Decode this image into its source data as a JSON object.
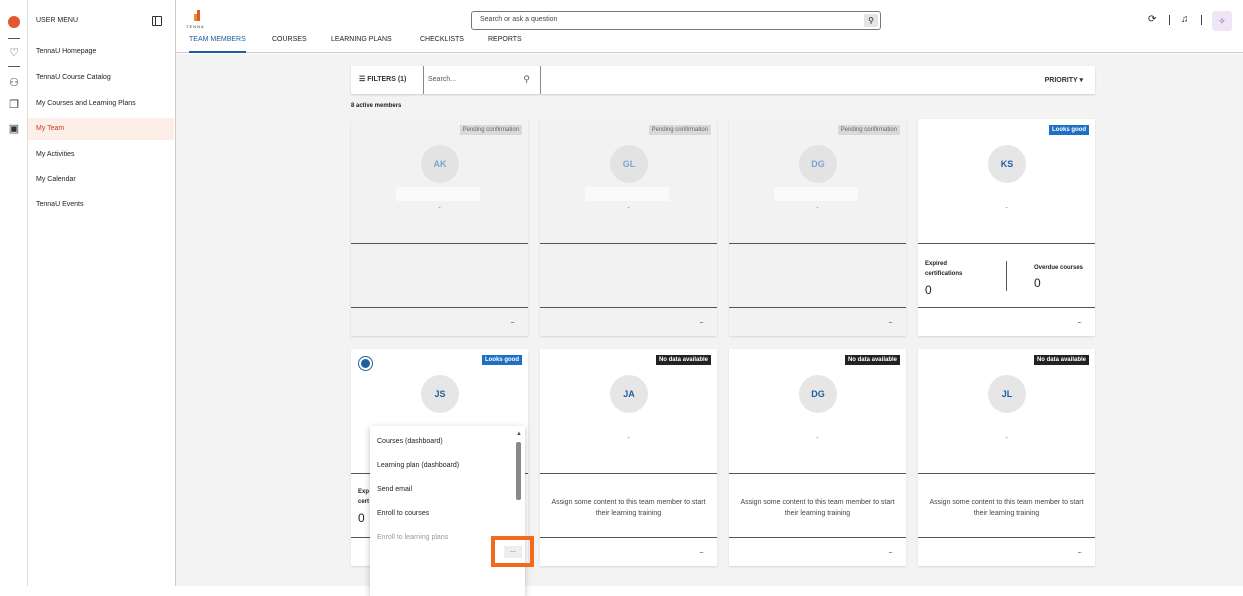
{
  "sidebar": {
    "header": "USER MENU",
    "items": [
      {
        "label": "TennaU Homepage",
        "active": false
      },
      {
        "label": "TennaU Course Catalog",
        "active": false
      },
      {
        "label": "My Courses and Learning Plans",
        "active": false
      },
      {
        "label": "My Team",
        "active": true
      },
      {
        "label": "My Activities",
        "active": false
      },
      {
        "label": "My Calendar",
        "active": false
      },
      {
        "label": "TennaU Events",
        "active": false
      }
    ]
  },
  "brand": {
    "name": "TENNA"
  },
  "search": {
    "placeholder": "Search or ask a question"
  },
  "tabs": [
    "TEAM MEMBERS",
    "COURSES",
    "LEARNING PLANS",
    "CHECKLISTS",
    "REPORTS"
  ],
  "filterbar": {
    "filters_label": "FILTERS (1)",
    "search_placeholder": "Search...",
    "sort_label": "PRIORITY"
  },
  "member_count": "8 active members",
  "cards": [
    {
      "initials": "AK",
      "badge": "Pending confirmation",
      "sub": "-"
    },
    {
      "initials": "GL",
      "badge": "Pending confirmation",
      "sub": "-"
    },
    {
      "initials": "DG",
      "badge": "Pending confirmation",
      "sub": "-"
    },
    {
      "initials": "KS",
      "badge": "Looks good",
      "sub": "-",
      "expired_label": "Expired certifications",
      "expired_value": "0",
      "overdue_label": "Overdue courses",
      "overdue_value": "0"
    },
    {
      "initials": "JS",
      "badge": "Looks good",
      "expired_value": "0"
    },
    {
      "initials": "JA",
      "badge": "No data available",
      "sub": "-",
      "assign_text": "Assign some content to this team member to start their learning training"
    },
    {
      "initials": "DG",
      "badge": "No data available",
      "sub": "-",
      "assign_text": "Assign some content to this team member to start their learning training"
    },
    {
      "initials": "JL",
      "badge": "No data available",
      "sub": "-",
      "assign_text": "Assign some content to this team member to start their learning training"
    }
  ],
  "more_label": "...",
  "dropdown": {
    "items": [
      "Courses (dashboard)",
      "Learning plan (dashboard)",
      "Send email",
      "Enroll to courses",
      "Enroll to learning plans"
    ]
  },
  "partial_text": {
    "exp": "Exp",
    "cert": "cert"
  },
  "colors": {
    "accent": "#1f5f9f",
    "brand": "#e4572e",
    "highlight": "#f26b1d",
    "looks_good": "#1f6fc5"
  }
}
